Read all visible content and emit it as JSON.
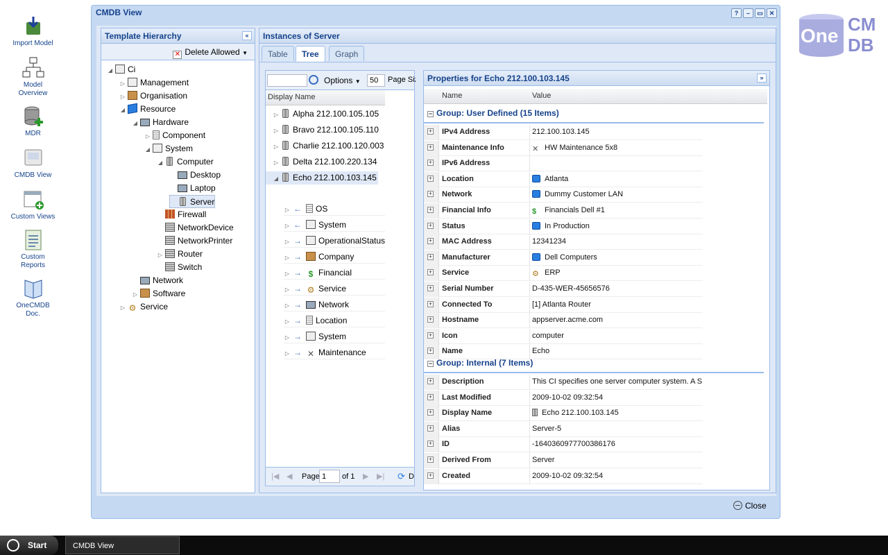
{
  "desktop": {
    "icons": [
      {
        "label": "Import Model",
        "icon": "import-model-icon"
      },
      {
        "label": "Model Overview",
        "icon": "model-overview-icon"
      },
      {
        "label": "MDR",
        "icon": "mdr-icon"
      },
      {
        "label": "CMDB View",
        "icon": "cmdb-view-icon"
      },
      {
        "label": "Custom Views",
        "icon": "custom-views-icon"
      },
      {
        "label": "Custom Reports",
        "icon": "custom-reports-icon"
      },
      {
        "label": "OneCMDB Doc.",
        "icon": "onecmdb-doc-icon"
      }
    ],
    "logo": {
      "one": "One",
      "cm": "CM",
      "db": "DB"
    }
  },
  "window": {
    "title": "CMDB View",
    "buttons": [
      "?",
      "–",
      "▭",
      "✕"
    ],
    "close_label": "Close"
  },
  "template_panel": {
    "title": "Template Hierarchy",
    "delete_label": "Delete Allowed",
    "tree": [
      {
        "label": "Ci",
        "icon": "ci-icon"
      },
      {
        "label": "Management",
        "icon": "ci-icon"
      },
      {
        "label": "Organisation",
        "icon": "box-icon"
      },
      {
        "label": "Resource",
        "icon": "cube-icon"
      },
      {
        "label": "Hardware",
        "icon": "monitor-icon"
      },
      {
        "label": "Component",
        "icon": "component-icon"
      },
      {
        "label": "System",
        "icon": "ci-icon"
      },
      {
        "label": "Computer",
        "icon": "server-icon"
      },
      {
        "label": "Desktop",
        "icon": "monitor-icon"
      },
      {
        "label": "Laptop",
        "icon": "laptop-icon"
      },
      {
        "label": "Server",
        "icon": "server-icon"
      },
      {
        "label": "Firewall",
        "icon": "firewall-icon"
      },
      {
        "label": "NetworkDevice",
        "icon": "network-device-icon"
      },
      {
        "label": "NetworkPrinter",
        "icon": "printer-icon"
      },
      {
        "label": "Router",
        "icon": "router-icon"
      },
      {
        "label": "Switch",
        "icon": "switch-icon"
      },
      {
        "label": "Network",
        "icon": "network-icon"
      },
      {
        "label": "Software",
        "icon": "software-icon"
      },
      {
        "label": "Service",
        "icon": "gear-icon"
      }
    ]
  },
  "instances_panel": {
    "title": "Instances of Server",
    "tabs": [
      "Table",
      "Tree",
      "Graph"
    ],
    "search_placeholder": "",
    "options_label": "Options",
    "page_size": "50",
    "page_size_label": "Page Size",
    "column": "Display Name",
    "items": [
      "Alpha 212.100.105.105",
      "Bravo 212.100.105.110",
      "Charlie 212.100.120.003",
      "Delta 212.100.220.134",
      "Echo 212.100.103.145"
    ],
    "children": [
      {
        "label": "OS",
        "dir": "in"
      },
      {
        "label": "System",
        "dir": "in"
      },
      {
        "label": "OperationalStatus",
        "dir": "out"
      },
      {
        "label": "Company",
        "dir": "out"
      },
      {
        "label": "Financial",
        "dir": "out"
      },
      {
        "label": "Service",
        "dir": "out"
      },
      {
        "label": "Network",
        "dir": "out"
      },
      {
        "label": "Location",
        "dir": "out"
      },
      {
        "label": "System",
        "dir": "out"
      },
      {
        "label": "Maintenance",
        "dir": "out"
      }
    ],
    "pager": {
      "page_label": "Page",
      "page": "1",
      "of": "of 1",
      "refresh_label": "D"
    }
  },
  "properties_panel": {
    "title": "Properties for Echo 212.100.103.145",
    "col_name": "Name",
    "col_value": "Value",
    "group_user": "Group: User Defined (15 Items)",
    "group_internal": "Group: Internal (7 Items)",
    "user_rows": [
      {
        "name": "IPv4 Address",
        "value": "212.100.103.145",
        "icon": ""
      },
      {
        "name": "Maintenance Info",
        "value": "HW Maintenance 5x8",
        "icon": "tools"
      },
      {
        "name": "IPv6 Address",
        "value": "",
        "icon": ""
      },
      {
        "name": "Location",
        "value": "Atlanta",
        "icon": "cube"
      },
      {
        "name": "Network",
        "value": "Dummy Customer LAN",
        "icon": "cube"
      },
      {
        "name": "Financial Info",
        "value": "Financials Dell #1",
        "icon": "dollar"
      },
      {
        "name": "Status",
        "value": "In Production",
        "icon": "cube"
      },
      {
        "name": "MAC Address",
        "value": "12341234",
        "icon": ""
      },
      {
        "name": "Manufacturer",
        "value": "Dell Computers",
        "icon": "cube"
      },
      {
        "name": "Service",
        "value": "ERP",
        "icon": "gear"
      },
      {
        "name": "Serial Number",
        "value": "D-435-WER-45656576",
        "icon": ""
      },
      {
        "name": "Connected To",
        "value": "[1] Atlanta Router",
        "icon": ""
      },
      {
        "name": "Hostname",
        "value": "appserver.acme.com",
        "icon": ""
      },
      {
        "name": "Icon",
        "value": "computer",
        "icon": ""
      },
      {
        "name": "Name",
        "value": "Echo",
        "icon": ""
      }
    ],
    "internal_rows": [
      {
        "name": "Description",
        "value": "This CI specifies one server computer system. A S",
        "icon": ""
      },
      {
        "name": "Last Modified",
        "value": "2009-10-02 09:32:54",
        "icon": ""
      },
      {
        "name": "Display Name",
        "value": "Echo 212.100.103.145",
        "icon": "server"
      },
      {
        "name": "Alias",
        "value": "Server-5",
        "icon": ""
      },
      {
        "name": "ID",
        "value": "-1640360977700386176",
        "icon": ""
      },
      {
        "name": "Derived From",
        "value": "Server",
        "icon": ""
      },
      {
        "name": "Created",
        "value": "2009-10-02 09:32:54",
        "icon": ""
      }
    ]
  },
  "taskbar": {
    "start_label": "Start",
    "task_label": "CMDB View"
  }
}
